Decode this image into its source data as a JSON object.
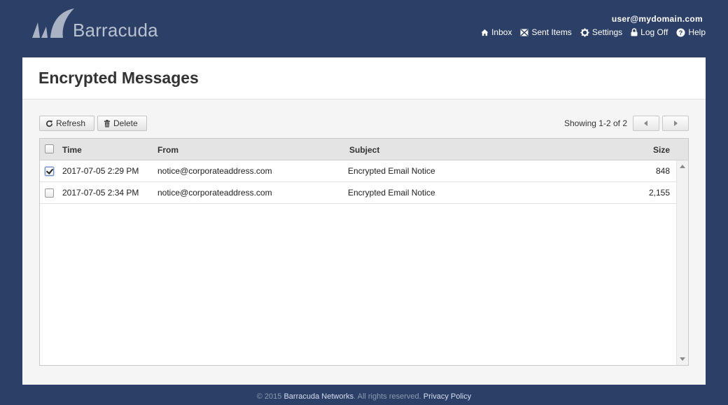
{
  "header": {
    "logo_text": "Barracuda",
    "user_email": "user@mydomain.com",
    "nav": {
      "inbox": "Inbox",
      "sent_items": "Sent Items",
      "settings": "Settings",
      "log_off": "Log Off",
      "help": "Help"
    }
  },
  "page": {
    "title": "Encrypted Messages"
  },
  "toolbar": {
    "refresh_label": "Refresh",
    "delete_label": "Delete",
    "showing": "Showing 1-2 of 2"
  },
  "grid": {
    "columns": {
      "time": "Time",
      "from": "From",
      "subject": "Subject",
      "size": "Size"
    },
    "rows": [
      {
        "checked": true,
        "time": "2017-07-05  2:29 PM",
        "from": "notice@corporateaddress.com",
        "subject": "Encrypted Email Notice",
        "size": "848"
      },
      {
        "checked": false,
        "time": "2017-07-05  2:34 PM",
        "from": "notice@corporateaddress.com",
        "subject": "Encrypted Email Notice",
        "size": "2,155"
      }
    ]
  },
  "footer": {
    "copyright": "© 2015",
    "company": "Barracuda Networks",
    "rights": ". All rights reserved.",
    "privacy": "Privacy Policy"
  },
  "colors": {
    "background": "#2c3f66",
    "panel": "#f5f5f5",
    "header_row": "#e4e4e4"
  }
}
